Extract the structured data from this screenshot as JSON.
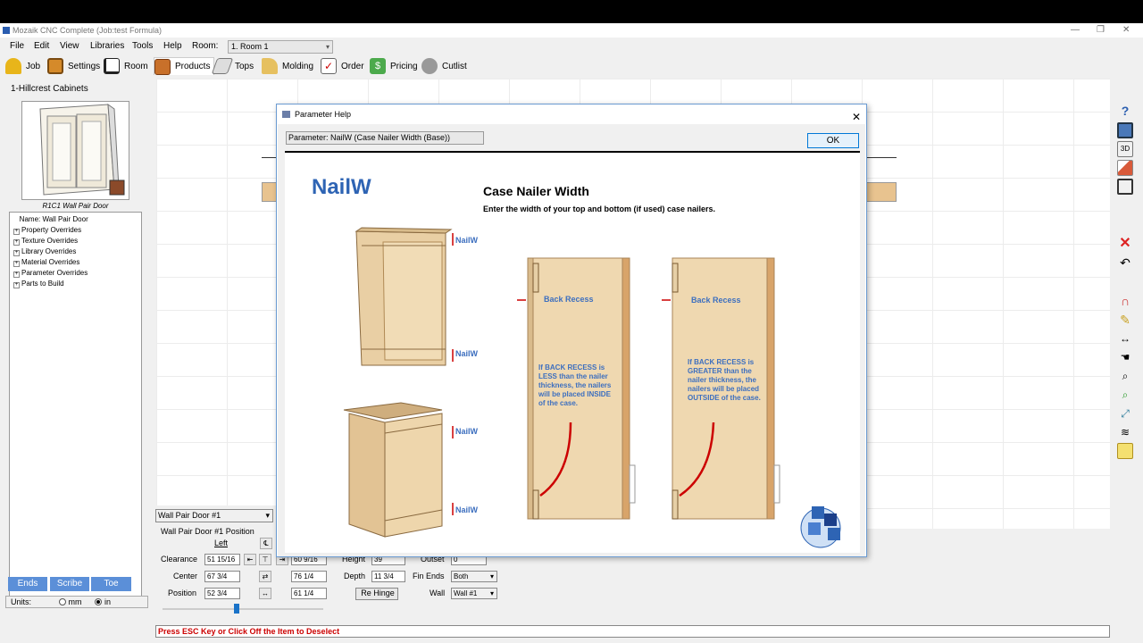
{
  "window": {
    "title": "Mozaik CNC Complete (Job:test Formula)"
  },
  "menu": {
    "items": [
      "File",
      "Edit",
      "View",
      "Libraries",
      "Tools",
      "Help"
    ],
    "room_label": "Room:",
    "room_value": "1. Room 1"
  },
  "toolbar": {
    "tabs": [
      "Job",
      "Settings",
      "Room",
      "Products",
      "Tops",
      "Molding",
      "Order",
      "Pricing",
      "Cutlist"
    ],
    "active": "Products"
  },
  "left": {
    "company": "1-Hillcrest Cabinets",
    "thumb_caption": "R1C1 Wall Pair Door",
    "tree": [
      "Name: Wall Pair Door",
      "Property Overrides",
      "Texture Overrides",
      "Library Overrides",
      "Material Overrides",
      "Parameter Overrides",
      "Parts to Build"
    ],
    "buttons": [
      "Ends",
      "Scribe",
      "Toe"
    ],
    "units_label": "Units:",
    "unit_mm": "mm",
    "unit_in": "in"
  },
  "position": {
    "product_select": "Wall Pair Door #1",
    "title": "Wall Pair Door #1 Position",
    "left_col": "Left",
    "rows": [
      {
        "label": "Clearance",
        "left": "51 15/16",
        "right": "60 9/16"
      },
      {
        "label": "Center",
        "left": "67 3/4",
        "right": "76 1/4"
      },
      {
        "label": "Position",
        "left": "52 3/4",
        "right": "61 1/4"
      }
    ],
    "height_label": "Height",
    "height_value": "39",
    "depth_label": "Depth",
    "depth_value": "11 3/4",
    "outset_label": "Outset",
    "outset_value": "0",
    "fin_ends_label": "Fin Ends",
    "fin_ends_value": "Both",
    "wall_label": "Wall",
    "wall_value": "Wall #1",
    "rehinge": "Re Hinge"
  },
  "status": "Press ESC Key or Click Off the Item to Deselect",
  "dialog": {
    "title": "Parameter Help",
    "param": "Parameter: NailW (Case Nailer Width (Base))",
    "ok": "OK",
    "big_title": "NailW",
    "heading": "Case Nailer Width",
    "subheading": "Enter the width of your top and bottom (if used) case nailers.",
    "nailw_label": "NailW",
    "back_recess": "Back Recess",
    "note_less": "If BACK RECESS is LESS than the nailer thickness, the nailers will be placed INSIDE of the case.",
    "note_greater": "If BACK RECESS is GREATER than the nailer thickness, the nailers will be placed OUTSIDE of the case."
  },
  "colors": {
    "accent": "#2e64b4",
    "button_blue": "#5b8fd8",
    "status_red": "#cc0000",
    "wood": "#e8c38f"
  }
}
